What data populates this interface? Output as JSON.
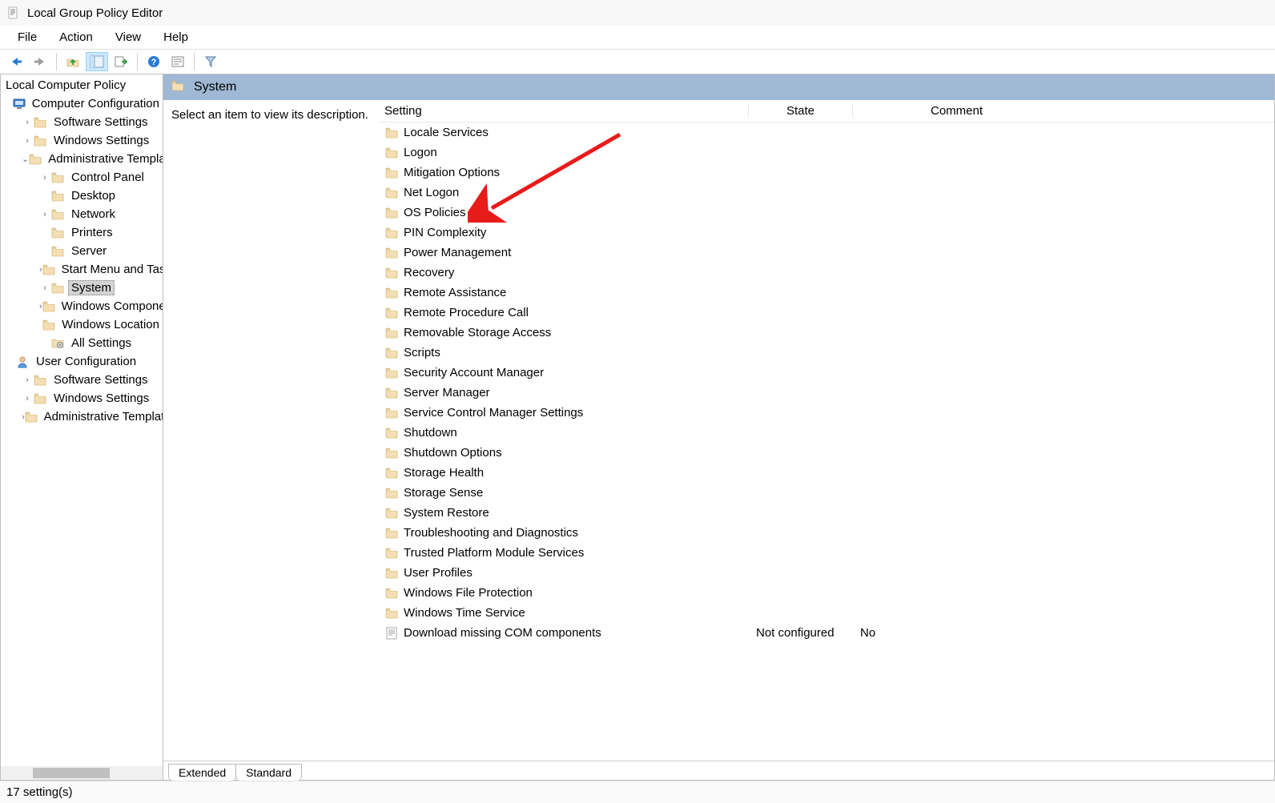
{
  "window": {
    "title": "Local Group Policy Editor"
  },
  "menubar": [
    "File",
    "Action",
    "View",
    "Help"
  ],
  "toolbar": {
    "buttons": [
      {
        "name": "back-icon",
        "kind": "arrow-left",
        "color": "#2a7bd6"
      },
      {
        "name": "forward-icon",
        "kind": "arrow-right",
        "color": "#9e9e9e"
      },
      {
        "sep": true
      },
      {
        "name": "up-folder-icon",
        "kind": "up-folder"
      },
      {
        "name": "show-tree-icon",
        "kind": "tree",
        "active": true
      },
      {
        "name": "export-list-icon",
        "kind": "export"
      },
      {
        "sep": true
      },
      {
        "name": "help-icon",
        "kind": "help"
      },
      {
        "name": "properties-icon",
        "kind": "properties"
      },
      {
        "sep": true
      },
      {
        "name": "filter-icon",
        "kind": "filter"
      }
    ]
  },
  "tree": {
    "root_label": "Local Computer Policy",
    "nodes": [
      {
        "depth": 0,
        "expander": "",
        "icon": "computer",
        "label": "Computer Configuration"
      },
      {
        "depth": 1,
        "expander": ">",
        "icon": "folder",
        "label": "Software Settings"
      },
      {
        "depth": 1,
        "expander": ">",
        "icon": "folder",
        "label": "Windows Settings"
      },
      {
        "depth": 1,
        "expander": "v",
        "icon": "folder",
        "label": "Administrative Templates"
      },
      {
        "depth": 2,
        "expander": ">",
        "icon": "folder",
        "label": "Control Panel"
      },
      {
        "depth": 2,
        "expander": "",
        "icon": "folder",
        "label": "Desktop"
      },
      {
        "depth": 2,
        "expander": ">",
        "icon": "folder",
        "label": "Network"
      },
      {
        "depth": 2,
        "expander": "",
        "icon": "folder",
        "label": "Printers"
      },
      {
        "depth": 2,
        "expander": "",
        "icon": "folder",
        "label": "Server"
      },
      {
        "depth": 2,
        "expander": ">",
        "icon": "folder",
        "label": "Start Menu and Taskbar"
      },
      {
        "depth": 2,
        "expander": ">",
        "icon": "folder",
        "label": "System",
        "selected": true
      },
      {
        "depth": 2,
        "expander": ">",
        "icon": "folder",
        "label": "Windows Components"
      },
      {
        "depth": 2,
        "expander": "",
        "icon": "folder",
        "label": "Windows Location"
      },
      {
        "depth": 2,
        "expander": "",
        "icon": "allsettings",
        "label": "All Settings"
      },
      {
        "depth": 0,
        "expander": "",
        "icon": "user",
        "label": "User Configuration"
      },
      {
        "depth": 1,
        "expander": ">",
        "icon": "folder",
        "label": "Software Settings"
      },
      {
        "depth": 1,
        "expander": ">",
        "icon": "folder",
        "label": "Windows Settings"
      },
      {
        "depth": 1,
        "expander": ">",
        "icon": "folder",
        "label": "Administrative Templates"
      }
    ]
  },
  "content": {
    "header": "System",
    "description_hint": "Select an item to view its description.",
    "columns": {
      "setting": "Setting",
      "state": "State",
      "comment": "Comment"
    },
    "rows": [
      {
        "icon": "folder",
        "setting": "Locale Services",
        "state": "",
        "comment": ""
      },
      {
        "icon": "folder",
        "setting": "Logon",
        "state": "",
        "comment": ""
      },
      {
        "icon": "folder",
        "setting": "Mitigation Options",
        "state": "",
        "comment": ""
      },
      {
        "icon": "folder",
        "setting": "Net Logon",
        "state": "",
        "comment": ""
      },
      {
        "icon": "folder",
        "setting": "OS Policies",
        "state": "",
        "comment": ""
      },
      {
        "icon": "folder",
        "setting": "PIN Complexity",
        "state": "",
        "comment": ""
      },
      {
        "icon": "folder",
        "setting": "Power Management",
        "state": "",
        "comment": ""
      },
      {
        "icon": "folder",
        "setting": "Recovery",
        "state": "",
        "comment": ""
      },
      {
        "icon": "folder",
        "setting": "Remote Assistance",
        "state": "",
        "comment": ""
      },
      {
        "icon": "folder",
        "setting": "Remote Procedure Call",
        "state": "",
        "comment": ""
      },
      {
        "icon": "folder",
        "setting": "Removable Storage Access",
        "state": "",
        "comment": ""
      },
      {
        "icon": "folder",
        "setting": "Scripts",
        "state": "",
        "comment": ""
      },
      {
        "icon": "folder",
        "setting": "Security Account Manager",
        "state": "",
        "comment": ""
      },
      {
        "icon": "folder",
        "setting": "Server Manager",
        "state": "",
        "comment": ""
      },
      {
        "icon": "folder",
        "setting": "Service Control Manager Settings",
        "state": "",
        "comment": ""
      },
      {
        "icon": "folder",
        "setting": "Shutdown",
        "state": "",
        "comment": ""
      },
      {
        "icon": "folder",
        "setting": "Shutdown Options",
        "state": "",
        "comment": ""
      },
      {
        "icon": "folder",
        "setting": "Storage Health",
        "state": "",
        "comment": ""
      },
      {
        "icon": "folder",
        "setting": "Storage Sense",
        "state": "",
        "comment": ""
      },
      {
        "icon": "folder",
        "setting": "System Restore",
        "state": "",
        "comment": ""
      },
      {
        "icon": "folder",
        "setting": "Troubleshooting and Diagnostics",
        "state": "",
        "comment": ""
      },
      {
        "icon": "folder",
        "setting": "Trusted Platform Module Services",
        "state": "",
        "comment": ""
      },
      {
        "icon": "folder",
        "setting": "User Profiles",
        "state": "",
        "comment": ""
      },
      {
        "icon": "folder",
        "setting": "Windows File Protection",
        "state": "",
        "comment": ""
      },
      {
        "icon": "folder",
        "setting": "Windows Time Service",
        "state": "",
        "comment": ""
      },
      {
        "icon": "policy",
        "setting": "Download missing COM components",
        "state": "Not configured",
        "comment": "No"
      }
    ],
    "tabs": {
      "extended": "Extended",
      "standard": "Standard",
      "active": "extended"
    }
  },
  "statusbar": {
    "text": "17 setting(s)"
  },
  "arrow": {
    "target_row": "OS Policies"
  }
}
